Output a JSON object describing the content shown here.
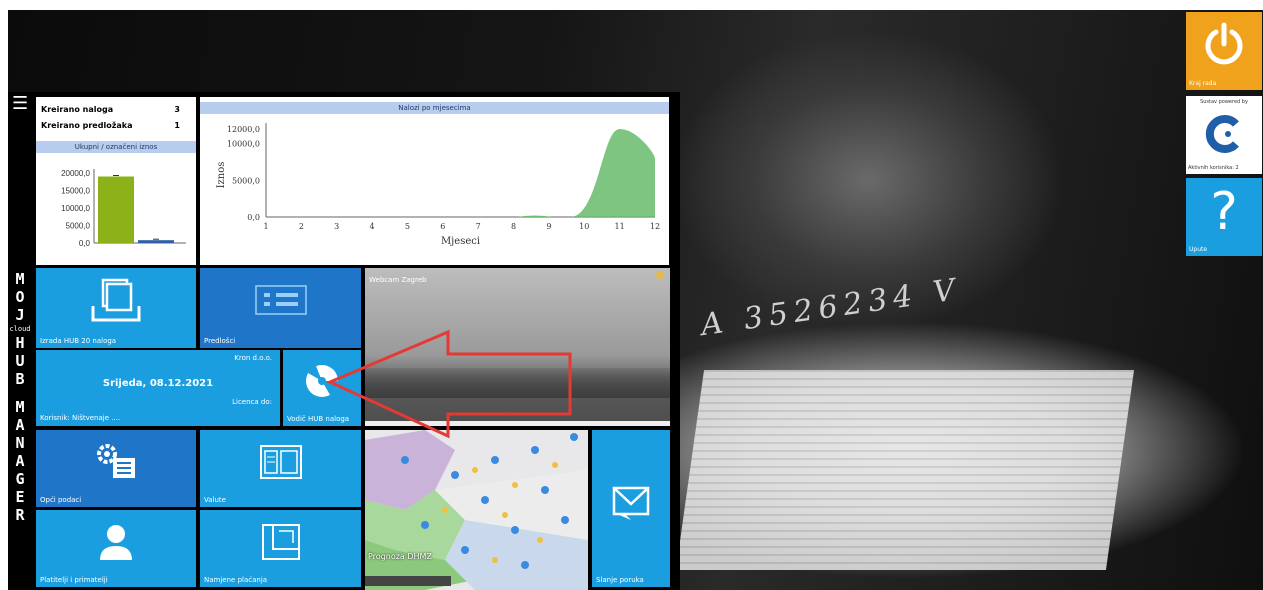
{
  "summary": {
    "created_orders_label": "Kreirano naloga",
    "created_orders_value": "3",
    "created_templates_label": "Kreirano predložaka",
    "created_templates_value": "1",
    "amount_header": "Ukupni / označeni iznos"
  },
  "amount_chart": {
    "type": "bar",
    "categories": [
      "Ukupni",
      "Označeni"
    ],
    "values": [
      19000,
      800
    ],
    "y_ticks": [
      "20000,0",
      "15000,0",
      "10000,0",
      "5000,0",
      "0,0"
    ],
    "ylim": [
      0,
      20000
    ],
    "colors": [
      "#8db219",
      "#2f5fa8"
    ]
  },
  "chart_data": {
    "type": "area",
    "title": "Nalozi po mjesecima",
    "xlabel": "Mjeseci",
    "ylabel": "Iznos",
    "x": [
      1,
      2,
      3,
      4,
      5,
      6,
      7,
      8,
      9,
      10,
      11,
      12
    ],
    "values": [
      0,
      0,
      0,
      0,
      0,
      0,
      0,
      0,
      0,
      0,
      12000,
      8000
    ],
    "y_ticks": [
      "12000,0",
      "10000,0",
      "5000,0",
      "0,0"
    ],
    "ylim": [
      0,
      12000
    ],
    "color": "#66bb6a"
  },
  "tiles": {
    "hub_create": "Izrada HUB 20 naloga",
    "templates": "Predlošci",
    "company": "Kron d.o.o.",
    "date": "Srijeda, 08.12.2021",
    "license": "Licenca do:",
    "user": "Korisnik: Ništvenaje ....",
    "hub_orders": "Vodič HUB naloga",
    "general": "Opći podaci",
    "currencies": "Valute",
    "partners": "Platitelji i primatelji",
    "payment_types": "Namjene plaćanja",
    "send_mail": "Slanje poruka",
    "webcam": "Webcam Zagreb",
    "forecast": "Prognoza DHMZ"
  },
  "brand": {
    "letters_top": [
      "M",
      "O",
      "J"
    ],
    "small": "cloud",
    "letters_mid": [
      "H",
      "U",
      "B"
    ],
    "letters_bottom": [
      "M",
      "A",
      "N",
      "A",
      "G",
      "E",
      "R"
    ]
  },
  "right": {
    "exit": "Kraj rada",
    "powered": "Sustav powered by",
    "contact": "Aktivnih korisnika: 2",
    "help": "Upute"
  },
  "colors": {
    "tile_blue": "#1a9ee0",
    "tile_dark": "#1f76c8",
    "exit_orange": "#f0a21c",
    "arrow_red": "#e53935"
  }
}
